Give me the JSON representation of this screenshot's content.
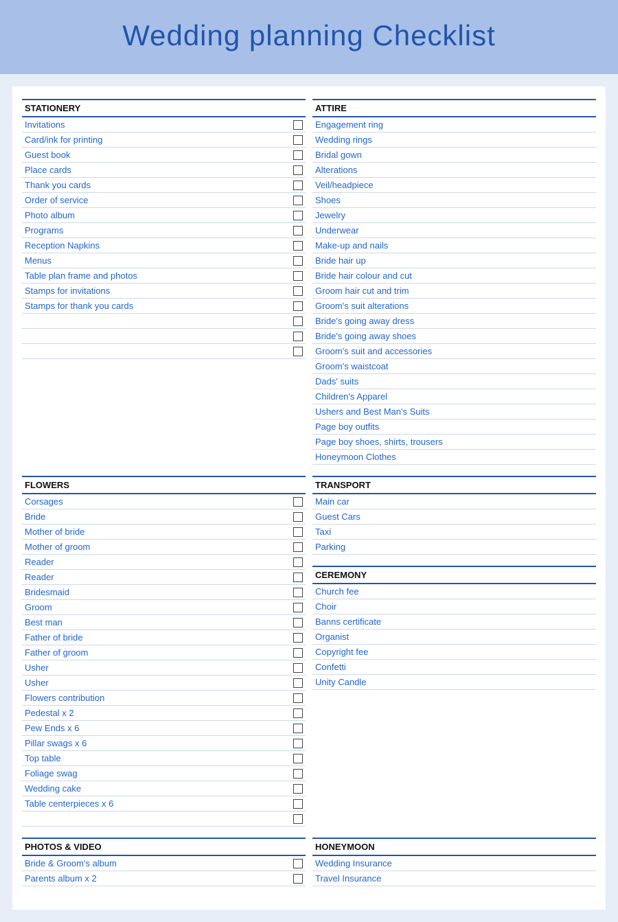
{
  "header": {
    "title": "Wedding planning Checklist"
  },
  "sections": {
    "stationery": {
      "title": "STATIONERY",
      "items": [
        "Invitations",
        "Card/ink for printing",
        "Guest book",
        "Place cards",
        "Thank you cards",
        "Order of service",
        "Photo album",
        "Programs",
        "Reception Napkins",
        "Menus",
        "Table plan frame and photos",
        "Stamps for invitations",
        "Stamps for thank you cards",
        "",
        "",
        ""
      ]
    },
    "attire": {
      "title": "ATTIRE",
      "items": [
        "Engagement ring",
        "Wedding rings",
        "Bridal gown",
        "Alterations",
        "Veil/headpiece",
        "Shoes",
        "Jewelry",
        "Underwear",
        "Make-up and nails",
        "Bride hair up",
        "Bride hair colour and cut",
        "Groom hair cut and trim",
        "Groom's suit alterations",
        "Bride's going away dress",
        "Bride's going away shoes",
        "Groom's suit and accessories",
        "Groom's waistcoat",
        "Dads' suits",
        "Children's Apparel",
        "Ushers and Best Man's Suits",
        "Page boy outfits",
        "Page boy shoes, shirts, trousers",
        "Honeymoon Clothes"
      ]
    },
    "flowers": {
      "title": "FLOWERS",
      "items": [
        "Corsages",
        "Bride",
        "Mother of bride",
        "Mother of groom",
        "Reader",
        "Reader",
        "Bridesmaid",
        "Groom",
        "Best man",
        "Father of bride",
        "Father of groom",
        "Usher",
        "Usher",
        "Flowers contribution",
        "Pedestal x 2",
        "Pew Ends x 6",
        "Pillar swags x 6",
        "Top table",
        "Foliage swag",
        "Wedding cake",
        "Table centerpieces x 6",
        ""
      ]
    },
    "transport": {
      "title": "TRANSPORT",
      "items": [
        "Main car",
        "Guest Cars",
        "Taxi",
        "Parking"
      ]
    },
    "ceremony": {
      "title": "CEREMONY",
      "items": [
        "Church fee",
        "Choir",
        "Banns certificate",
        "Organist",
        "Copyright fee",
        "Confetti",
        "Unity Candle"
      ]
    },
    "photos_video": {
      "title": "PHOTOS & VIDEO",
      "items": [
        "Bride & Groom's album",
        "Parents album x 2"
      ]
    },
    "honeymoon": {
      "title": "HONEYMOON",
      "items": [
        "Wedding Insurance",
        "Travel Insurance"
      ]
    }
  }
}
